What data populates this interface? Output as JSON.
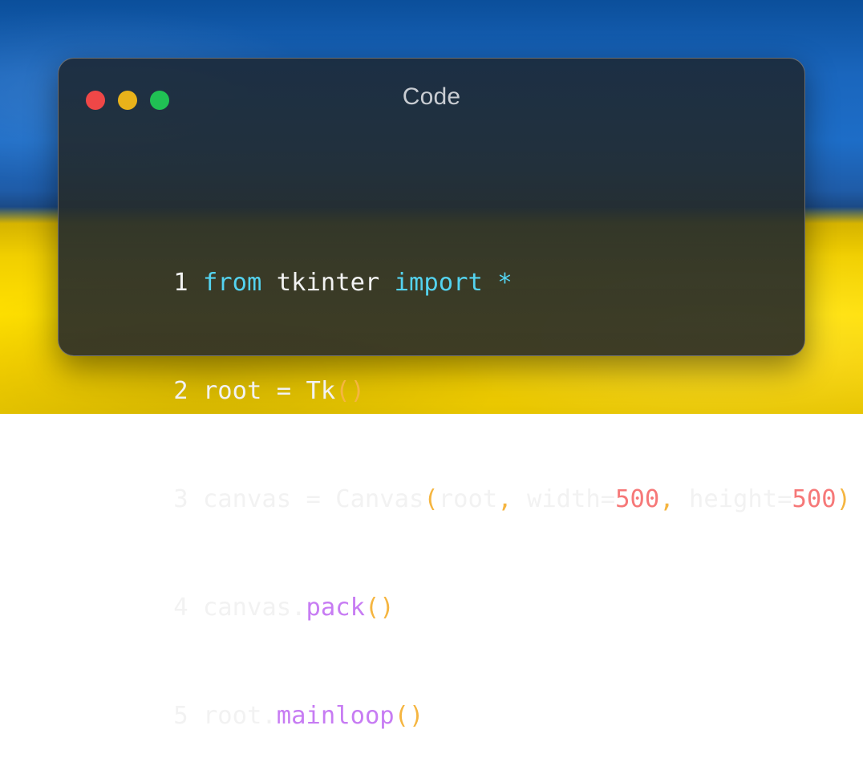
{
  "window": {
    "title": "Code"
  },
  "colors": {
    "flag_blue": "#1d6dc7",
    "flag_yellow": "#ffe000",
    "window_background": "#26303a",
    "traffic_close": "#ef4747",
    "traffic_minimize": "#e9b21a",
    "traffic_zoom": "#20c154",
    "keyword": "#54d3f0",
    "punctuation": "#f5b540",
    "number": "#f67878",
    "method": "#c77cf3",
    "default_text": "#f2f2f2"
  },
  "code": {
    "lines": [
      {
        "number": "1",
        "tokens": [
          {
            "text": "from",
            "type": "keyword"
          },
          {
            "text": " tkinter ",
            "type": "text"
          },
          {
            "text": "import",
            "type": "keyword"
          },
          {
            "text": " ",
            "type": "text"
          },
          {
            "text": "*",
            "type": "keyword"
          }
        ]
      },
      {
        "number": "2",
        "tokens": [
          {
            "text": "root = Tk",
            "type": "text"
          },
          {
            "text": "()",
            "type": "punctuation"
          }
        ]
      },
      {
        "number": "3",
        "tokens": [
          {
            "text": "canvas = Canvas",
            "type": "text"
          },
          {
            "text": "(",
            "type": "punctuation"
          },
          {
            "text": "root",
            "type": "text"
          },
          {
            "text": ",",
            "type": "punctuation"
          },
          {
            "text": " width=",
            "type": "text"
          },
          {
            "text": "500",
            "type": "number"
          },
          {
            "text": ",",
            "type": "punctuation"
          },
          {
            "text": " height=",
            "type": "text"
          },
          {
            "text": "500",
            "type": "number"
          },
          {
            "text": ")",
            "type": "punctuation"
          }
        ]
      },
      {
        "number": "4",
        "tokens": [
          {
            "text": "canvas.",
            "type": "text"
          },
          {
            "text": "pack",
            "type": "method"
          },
          {
            "text": "()",
            "type": "punctuation"
          }
        ]
      },
      {
        "number": "5",
        "tokens": [
          {
            "text": "root.",
            "type": "text"
          },
          {
            "text": "mainloop",
            "type": "method"
          },
          {
            "text": "()",
            "type": "punctuation"
          }
        ]
      }
    ]
  }
}
